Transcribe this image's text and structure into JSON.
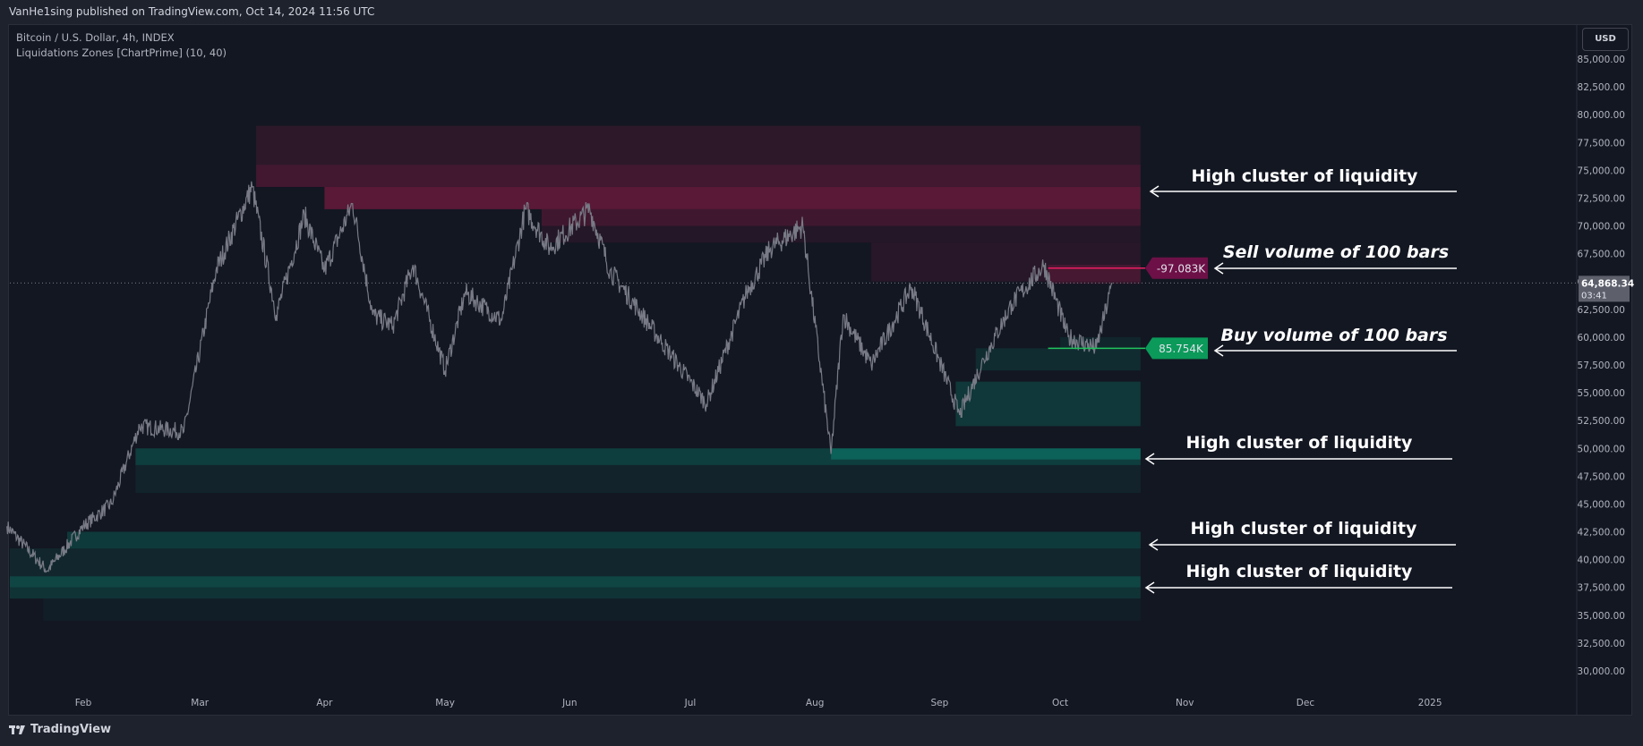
{
  "header": {
    "published": "VanHe1sing published on TradingView.com, Oct 14, 2024 11:56 UTC"
  },
  "legend": {
    "symbol": "Bitcoin / U.S. Dollar, 4h, INDEX",
    "indicator": "Liquidations Zones [ChartPrime] (10, 40)"
  },
  "currency_button": "USD",
  "footer": {
    "brand": "TradingView"
  },
  "colors": {
    "background": "#131722",
    "price": "#787b86",
    "sell": "#e91e63",
    "buy": "#089981",
    "sell_label": "#6d1047",
    "buy_label": "#0b9a5a"
  },
  "annotations": [
    {
      "text": "High cluster of liquidity",
      "italic": false
    },
    {
      "text": "Sell volume of 100 bars",
      "italic": true
    },
    {
      "text": "Buy volume of 100 bars",
      "italic": true
    },
    {
      "text": "High cluster of liquidity",
      "italic": false
    },
    {
      "text": "High cluster of liquidity",
      "italic": false
    },
    {
      "text": "High cluster of liquidity",
      "italic": false
    }
  ],
  "chart_data": {
    "type": "line",
    "title": "Bitcoin / U.S. Dollar, 4h, INDEX",
    "ylim": [
      27500,
      87500
    ],
    "yticks": [
      "85,000.00",
      "82,500.00",
      "80,000.00",
      "77,500.00",
      "75,000.00",
      "72,500.00",
      "70,000.00",
      "67,500.00",
      "65,000.00",
      "62,500.00",
      "60,000.00",
      "57,500.00",
      "55,000.00",
      "52,500.00",
      "50,000.00",
      "47,500.00",
      "45,000.00",
      "42,500.00",
      "40,000.00",
      "37,500.00",
      "35,000.00",
      "32,500.00",
      "30,000.00"
    ],
    "ytick_values": [
      85000,
      82500,
      80000,
      77500,
      75000,
      72500,
      70000,
      67500,
      65000,
      62500,
      60000,
      57500,
      55000,
      52500,
      50000,
      47500,
      45000,
      42500,
      40000,
      37500,
      35000,
      32500,
      30000
    ],
    "xticks": [
      {
        "label": "Feb",
        "date": "2024-02-01"
      },
      {
        "label": "Mar",
        "date": "2024-03-01"
      },
      {
        "label": "Apr",
        "date": "2024-04-01"
      },
      {
        "label": "May",
        "date": "2024-05-01"
      },
      {
        "label": "Jun",
        "date": "2024-06-01"
      },
      {
        "label": "Jul",
        "date": "2024-07-01"
      },
      {
        "label": "Aug",
        "date": "2024-08-01"
      },
      {
        "label": "Sep",
        "date": "2024-09-01"
      },
      {
        "label": "Oct",
        "date": "2024-10-01"
      },
      {
        "label": "Nov",
        "date": "2024-11-01"
      },
      {
        "label": "Dec",
        "date": "2024-12-01"
      },
      {
        "label": "2025",
        "date": "2025-01-01"
      }
    ],
    "price_series": [
      [
        "2024-01-13",
        43000
      ],
      [
        "2024-01-23",
        39000
      ],
      [
        "2024-02-01",
        43000
      ],
      [
        "2024-02-08",
        45000
      ],
      [
        "2024-02-15",
        52000
      ],
      [
        "2024-02-26",
        51500
      ],
      [
        "2024-03-05",
        66000
      ],
      [
        "2024-03-14",
        73500
      ],
      [
        "2024-03-20",
        62000
      ],
      [
        "2024-03-27",
        71000
      ],
      [
        "2024-04-01",
        66000
      ],
      [
        "2024-04-08",
        72000
      ],
      [
        "2024-04-13",
        62000
      ],
      [
        "2024-04-18",
        61000
      ],
      [
        "2024-04-23",
        66500
      ],
      [
        "2024-05-01",
        57000
      ],
      [
        "2024-05-06",
        64000
      ],
      [
        "2024-05-15",
        61500
      ],
      [
        "2024-05-21",
        71500
      ],
      [
        "2024-05-27",
        68000
      ],
      [
        "2024-06-06",
        71500
      ],
      [
        "2024-06-11",
        66000
      ],
      [
        "2024-06-24",
        59500
      ],
      [
        "2024-07-05",
        54000
      ],
      [
        "2024-07-15",
        64000
      ],
      [
        "2024-07-21",
        68000
      ],
      [
        "2024-07-29",
        70000
      ],
      [
        "2024-08-05",
        49500
      ],
      [
        "2024-08-08",
        62000
      ],
      [
        "2024-08-15",
        57500
      ],
      [
        "2024-08-25",
        64500
      ],
      [
        "2024-09-06",
        53000
      ],
      [
        "2024-09-12",
        58000
      ],
      [
        "2024-09-19",
        63000
      ],
      [
        "2024-09-27",
        66500
      ],
      [
        "2024-10-03",
        60000
      ],
      [
        "2024-10-10",
        59000
      ],
      [
        "2024-10-14",
        64868.34
      ]
    ],
    "last_price": {
      "value": 64868.34,
      "label": "64,868.34",
      "countdown": "03:41"
    },
    "zones": [
      {
        "side": "sell",
        "from": "2024-03-15",
        "to": "2024-10-21",
        "low": 75500,
        "high": 79000,
        "intensity": 0.22
      },
      {
        "side": "sell",
        "from": "2024-03-15",
        "to": "2024-10-21",
        "low": 73500,
        "high": 75500,
        "intensity": 0.4
      },
      {
        "side": "sell",
        "from": "2024-04-01",
        "to": "2024-10-21",
        "low": 71500,
        "high": 73500,
        "intensity": 0.6
      },
      {
        "side": "sell",
        "from": "2024-05-25",
        "to": "2024-10-21",
        "low": 70000,
        "high": 71500,
        "intensity": 0.38
      },
      {
        "side": "sell",
        "from": "2024-05-25",
        "to": "2024-10-21",
        "low": 68500,
        "high": 70000,
        "intensity": 0.15
      },
      {
        "side": "sell",
        "from": "2024-08-15",
        "to": "2024-10-21",
        "low": 65000,
        "high": 68500,
        "intensity": 0.18
      },
      {
        "side": "sell",
        "from": "2024-09-28",
        "to": "2024-10-21",
        "low": 64800,
        "high": 66500,
        "intensity": 0.3
      },
      {
        "side": "buy",
        "from": "2024-09-10",
        "to": "2024-10-21",
        "low": 57000,
        "high": 59000,
        "intensity": 0.3
      },
      {
        "side": "buy",
        "from": "2024-10-01",
        "to": "2024-10-21",
        "low": 59000,
        "high": 60000,
        "intensity": 0.2
      },
      {
        "side": "buy",
        "from": "2024-09-05",
        "to": "2024-10-21",
        "low": 52000,
        "high": 56000,
        "intensity": 0.45
      },
      {
        "side": "buy",
        "from": "2024-02-14",
        "to": "2024-10-21",
        "low": 48500,
        "high": 50000,
        "intensity": 0.55
      },
      {
        "side": "buy",
        "from": "2024-02-14",
        "to": "2024-10-21",
        "low": 46000,
        "high": 48500,
        "intensity": 0.18
      },
      {
        "side": "buy",
        "from": "2024-08-05",
        "to": "2024-10-21",
        "low": 49000,
        "high": 50000,
        "intensity": 0.7
      },
      {
        "side": "buy",
        "from": "2024-01-28",
        "to": "2024-10-21",
        "low": 41000,
        "high": 42500,
        "intensity": 0.5
      },
      {
        "side": "buy",
        "from": "2024-01-13",
        "to": "2024-10-21",
        "low": 38500,
        "high": 41000,
        "intensity": 0.22
      },
      {
        "side": "buy",
        "from": "2024-01-13",
        "to": "2024-10-21",
        "low": 37500,
        "high": 38500,
        "intensity": 0.65
      },
      {
        "side": "buy",
        "from": "2024-01-13",
        "to": "2024-10-21",
        "low": 36500,
        "high": 37500,
        "intensity": 0.4
      },
      {
        "side": "buy",
        "from": "2024-01-22",
        "to": "2024-10-21",
        "low": 34500,
        "high": 36500,
        "intensity": 0.1
      }
    ],
    "sell_volume": {
      "label": "-97.083K",
      "price": 66200,
      "from": "2024-09-28"
    },
    "buy_volume": {
      "label": "85.754K",
      "price": 59000,
      "from": "2024-09-28"
    }
  }
}
